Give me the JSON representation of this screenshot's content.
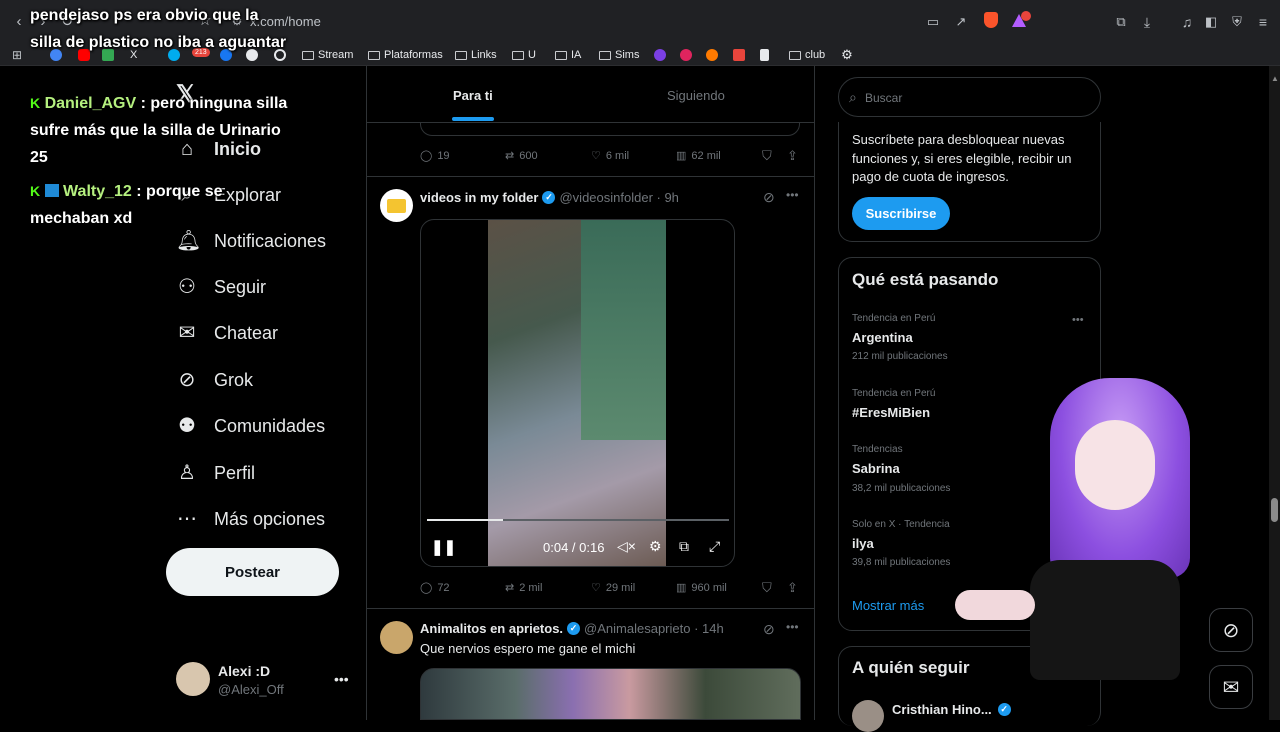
{
  "browser": {
    "url": "x.com/home",
    "bookmarks": [
      "Stream",
      "Plataformas",
      "Links",
      "U",
      "IA",
      "Sims",
      "club"
    ],
    "x_label": "X",
    "badge_count": "213"
  },
  "chat_overlay": [
    {
      "user": "",
      "text": "pendejaso ps era obvio que la silla de plastico no iba a aguantar"
    },
    {
      "user": "Daniel_AGV",
      "text": ": pero ninguna silla sufre más que la silla de Urinario 25"
    },
    {
      "user": "Walty_12",
      "text": ": porque se mechaban xd"
    }
  ],
  "nav": {
    "items": [
      "Inicio",
      "Explorar",
      "Notificaciones",
      "Seguir",
      "Chatear",
      "Grok",
      "Comunidades",
      "Perfil",
      "Más opciones"
    ],
    "post_label": "Postear",
    "account_name": "Alexi :D",
    "account_handle": "@Alexi_Off"
  },
  "feed": {
    "tabs": [
      "Para ti",
      "Siguiendo"
    ],
    "tweet0_actions": {
      "replies": "19",
      "reposts": "600",
      "likes": "6 mil",
      "views": "62 mil"
    },
    "tweet1": {
      "name": "videos in my folder",
      "handle": "@videosinfolder · 9h",
      "time": "0:04 / 0:16",
      "actions": {
        "replies": "72",
        "reposts": "2 mil",
        "likes": "29 mil",
        "views": "960 mil"
      },
      "progress": 0.25
    },
    "tweet2": {
      "name": "Animalitos en aprietos.",
      "handle": "@Animalesaprieto · 14h",
      "text": "Que nervios espero me gane el michi"
    }
  },
  "right": {
    "search_placeholder": "Buscar",
    "premium_text": "Suscríbete para desbloquear nuevas funciones y, si eres elegible, recibir un pago de cuota de ingresos.",
    "subscribe_label": "Suscribirse",
    "trends_title": "Qué está pasando",
    "trends": [
      {
        "category": "Tendencia en Perú",
        "name": "Argentina",
        "count": "212 mil publicaciones"
      },
      {
        "category": "Tendencia en Perú",
        "name": "#EresMiBien",
        "count": ""
      },
      {
        "category": "Tendencias",
        "name": "Sabrina",
        "count": "38,2 mil publicaciones"
      },
      {
        "category": "Solo en X · Tendencia",
        "name": "ilya",
        "count": "39,8 mil publicaciones"
      }
    ],
    "show_more": "Mostrar más",
    "follow_title": "A quién seguir",
    "follow_name": "Cristhian Hino...",
    "colors": {
      "accent": "#1d9bf0",
      "bg": "#000000",
      "muted": "#71767b"
    }
  }
}
